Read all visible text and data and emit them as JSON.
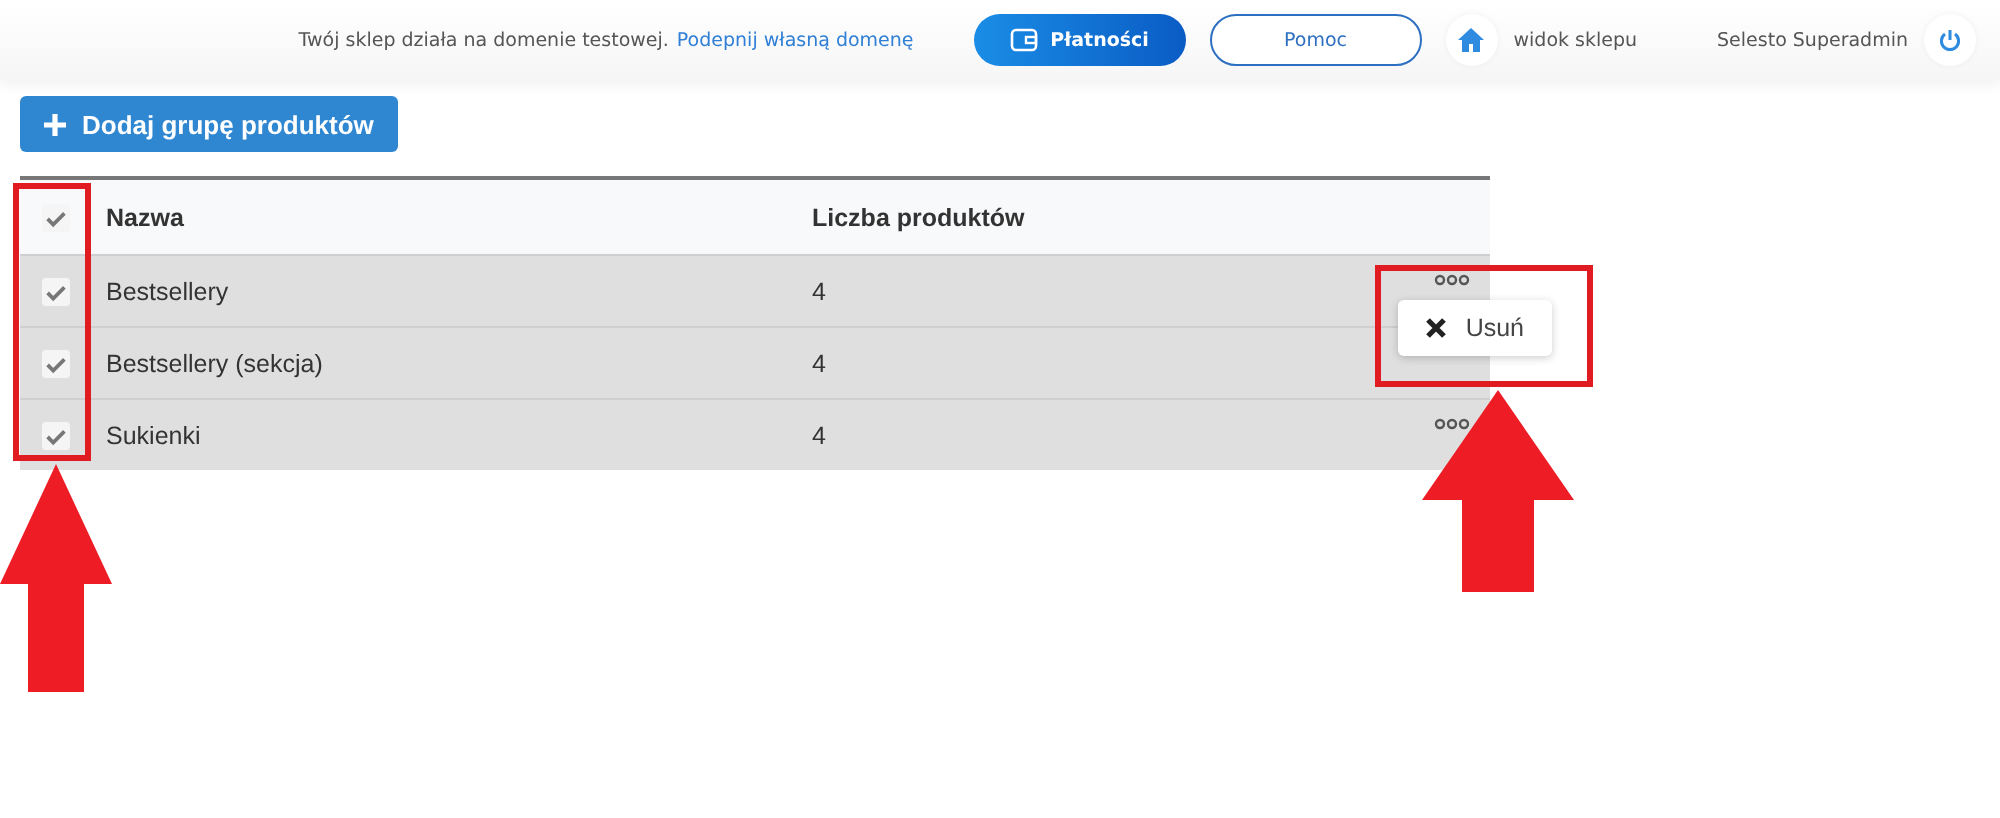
{
  "topbar": {
    "notice": "Twój sklep działa na domenie testowej.",
    "notice_link": "Podepnij własną domenę",
    "buttons": [
      {
        "label": "Płatności",
        "kind": "primary"
      },
      {
        "label": "Pomoc",
        "kind": "outline"
      }
    ],
    "shop_link": "widok sklepu",
    "user": "Selesto Superadmin"
  },
  "add_button": "Dodaj grupę produktów",
  "table": {
    "header_checked": true,
    "columns": [
      "Nazwa",
      "Liczba produktów"
    ],
    "rows": [
      {
        "name": "Bestsellery",
        "count": "4",
        "checked": true,
        "menu_open": true
      },
      {
        "name": "Bestsellery (sekcja)",
        "count": "4",
        "checked": true,
        "menu_open": false
      },
      {
        "name": "Sukienki",
        "count": "4",
        "checked": true,
        "menu_open": false
      }
    ]
  },
  "row_menu": {
    "items": [
      "Usuń"
    ]
  }
}
